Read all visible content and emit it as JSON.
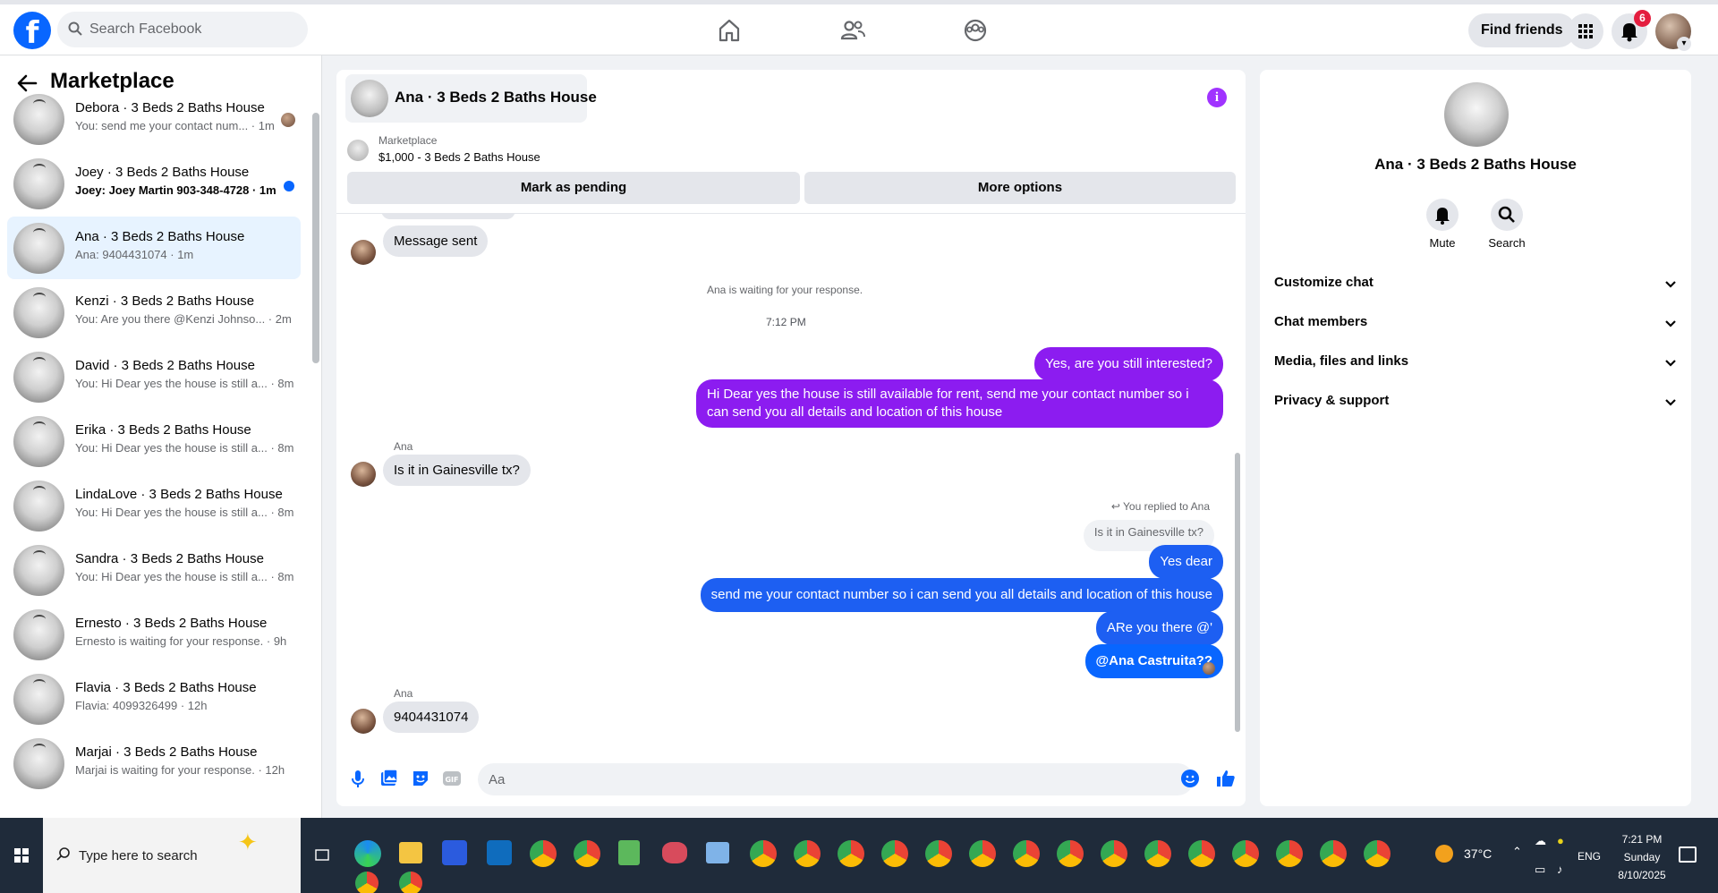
{
  "topnav": {
    "search_placeholder": "Search Facebook",
    "find_friends_label": "Find friends",
    "notifications_count": "6",
    "brand_color": "#0866ff"
  },
  "sidebar": {
    "title": "Marketplace",
    "conversations": [
      {
        "name": "Debora · 3 Beds 2 Baths House",
        "preview": "You: send me your contact num... · 1m"
      },
      {
        "name": "Joey · 3 Beds 2 Baths House",
        "preview": "Joey: Joey Martin 903-348-4728 · 1m",
        "unread": true
      },
      {
        "name": "Ana · 3 Beds 2 Baths House",
        "preview": "Ana: 9404431074 · 1m",
        "active": true
      },
      {
        "name": "Kenzi · 3 Beds 2 Baths House",
        "preview": "You: Are you there @Kenzi Johnso... · 2m"
      },
      {
        "name": "David · 3 Beds 2 Baths House",
        "preview": "You: Hi Dear yes the house is still a... · 8m"
      },
      {
        "name": "Erika · 3 Beds 2 Baths House",
        "preview": "You: Hi Dear yes the house is still a... · 8m"
      },
      {
        "name": "LindaLove · 3 Beds 2 Baths House",
        "preview": "You: Hi Dear yes the house is still a... · 8m"
      },
      {
        "name": "Sandra · 3 Beds 2 Baths House",
        "preview": "You: Hi Dear yes the house is still a... · 8m"
      },
      {
        "name": "Ernesto · 3 Beds 2 Baths House",
        "preview": "Ernesto is waiting for your response. · 9h"
      },
      {
        "name": "Flavia · 3 Beds 2 Baths House",
        "preview": "Flavia: 4099326499 · 12h"
      },
      {
        "name": "Marjai · 3 Beds 2 Baths House",
        "preview": "Marjai is waiting for your response. · 12h"
      }
    ]
  },
  "chat": {
    "title": "Ana · 3 Beds 2 Baths House",
    "listing_label": "Marketplace",
    "listing_price": "$1,000 - 3 Beds 2 Baths House",
    "mark_pending_label": "Mark as pending",
    "more_options_label": "More options",
    "msg_sent": "Message sent",
    "waiting_text": "Ana is waiting for your response.",
    "time_divider": "7:12 PM",
    "out_1": "Yes, are you still interested?",
    "out_2": "Hi Dear yes the house is still available for rent, send me your contact number so i can send you all details and location of this house",
    "sender_1": "Ana",
    "in_1": "Is it in Gainesville tx?",
    "replied_label": "You replied to Ana",
    "quoted_text": "Is it in Gainesville tx?",
    "out_3": "Yes dear",
    "out_4": "send me your contact number so i can send you all details and location of this house",
    "out_5": "ARe you there @'",
    "out_6": "@Ana Castruita??",
    "sender_2": "Ana",
    "in_2": "9404431074",
    "composer_placeholder": "Aa",
    "purple": "#8c1cf0",
    "blue": "#0866ff"
  },
  "rightpanel": {
    "name": "Ana · 3 Beds 2 Baths House",
    "mute_label": "Mute",
    "search_label": "Search",
    "rows": [
      "Customize chat",
      "Chat members",
      "Media, files and links",
      "Privacy & support"
    ]
  },
  "taskbar": {
    "search_text": "Type here to search",
    "temperature": "37°C",
    "language": "ENG",
    "time": "7:21 PM",
    "day": "Sunday",
    "date": "8/10/2025"
  }
}
